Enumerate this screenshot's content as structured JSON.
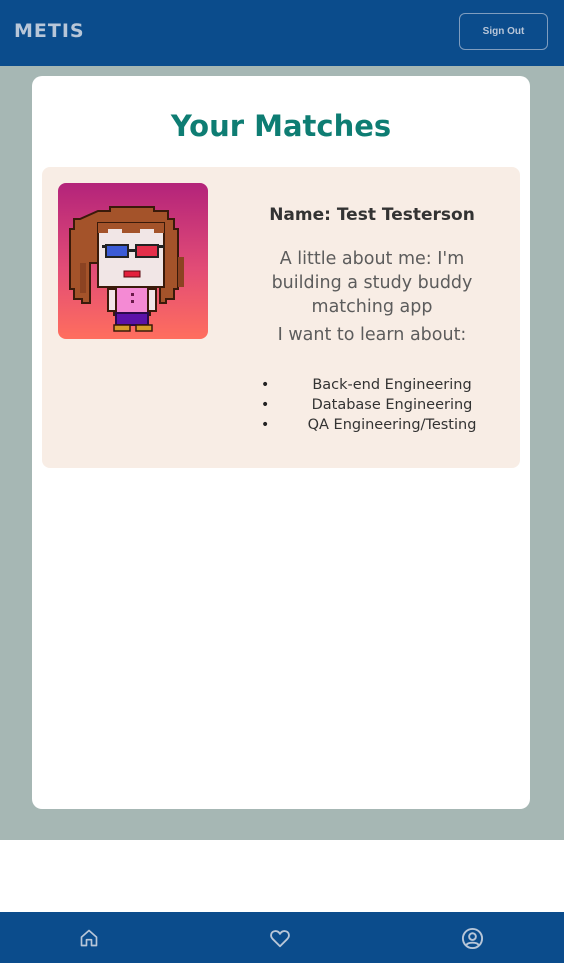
{
  "header": {
    "brand": "METIS",
    "sign_out_label": "Sign Out"
  },
  "page": {
    "title": "Your Matches"
  },
  "match": {
    "name": "Name: Test Testerson",
    "about": "A little about me: I'm building a study buddy matching app",
    "learn_heading": "I want to learn about:",
    "topics": [
      "Back-end Engineering",
      "Database Engineering",
      "QA Engineering/Testing"
    ],
    "avatar_icon": "pixel-art-avatar"
  },
  "nav": {
    "items": [
      {
        "icon": "home-icon"
      },
      {
        "icon": "heart-icon"
      },
      {
        "icon": "user-circle-icon"
      }
    ]
  },
  "colors": {
    "header_bg": "#0b4c8c",
    "stage_bg": "#a6b7b4",
    "title": "#0e7d73",
    "card_bg": "#f8ede5"
  }
}
